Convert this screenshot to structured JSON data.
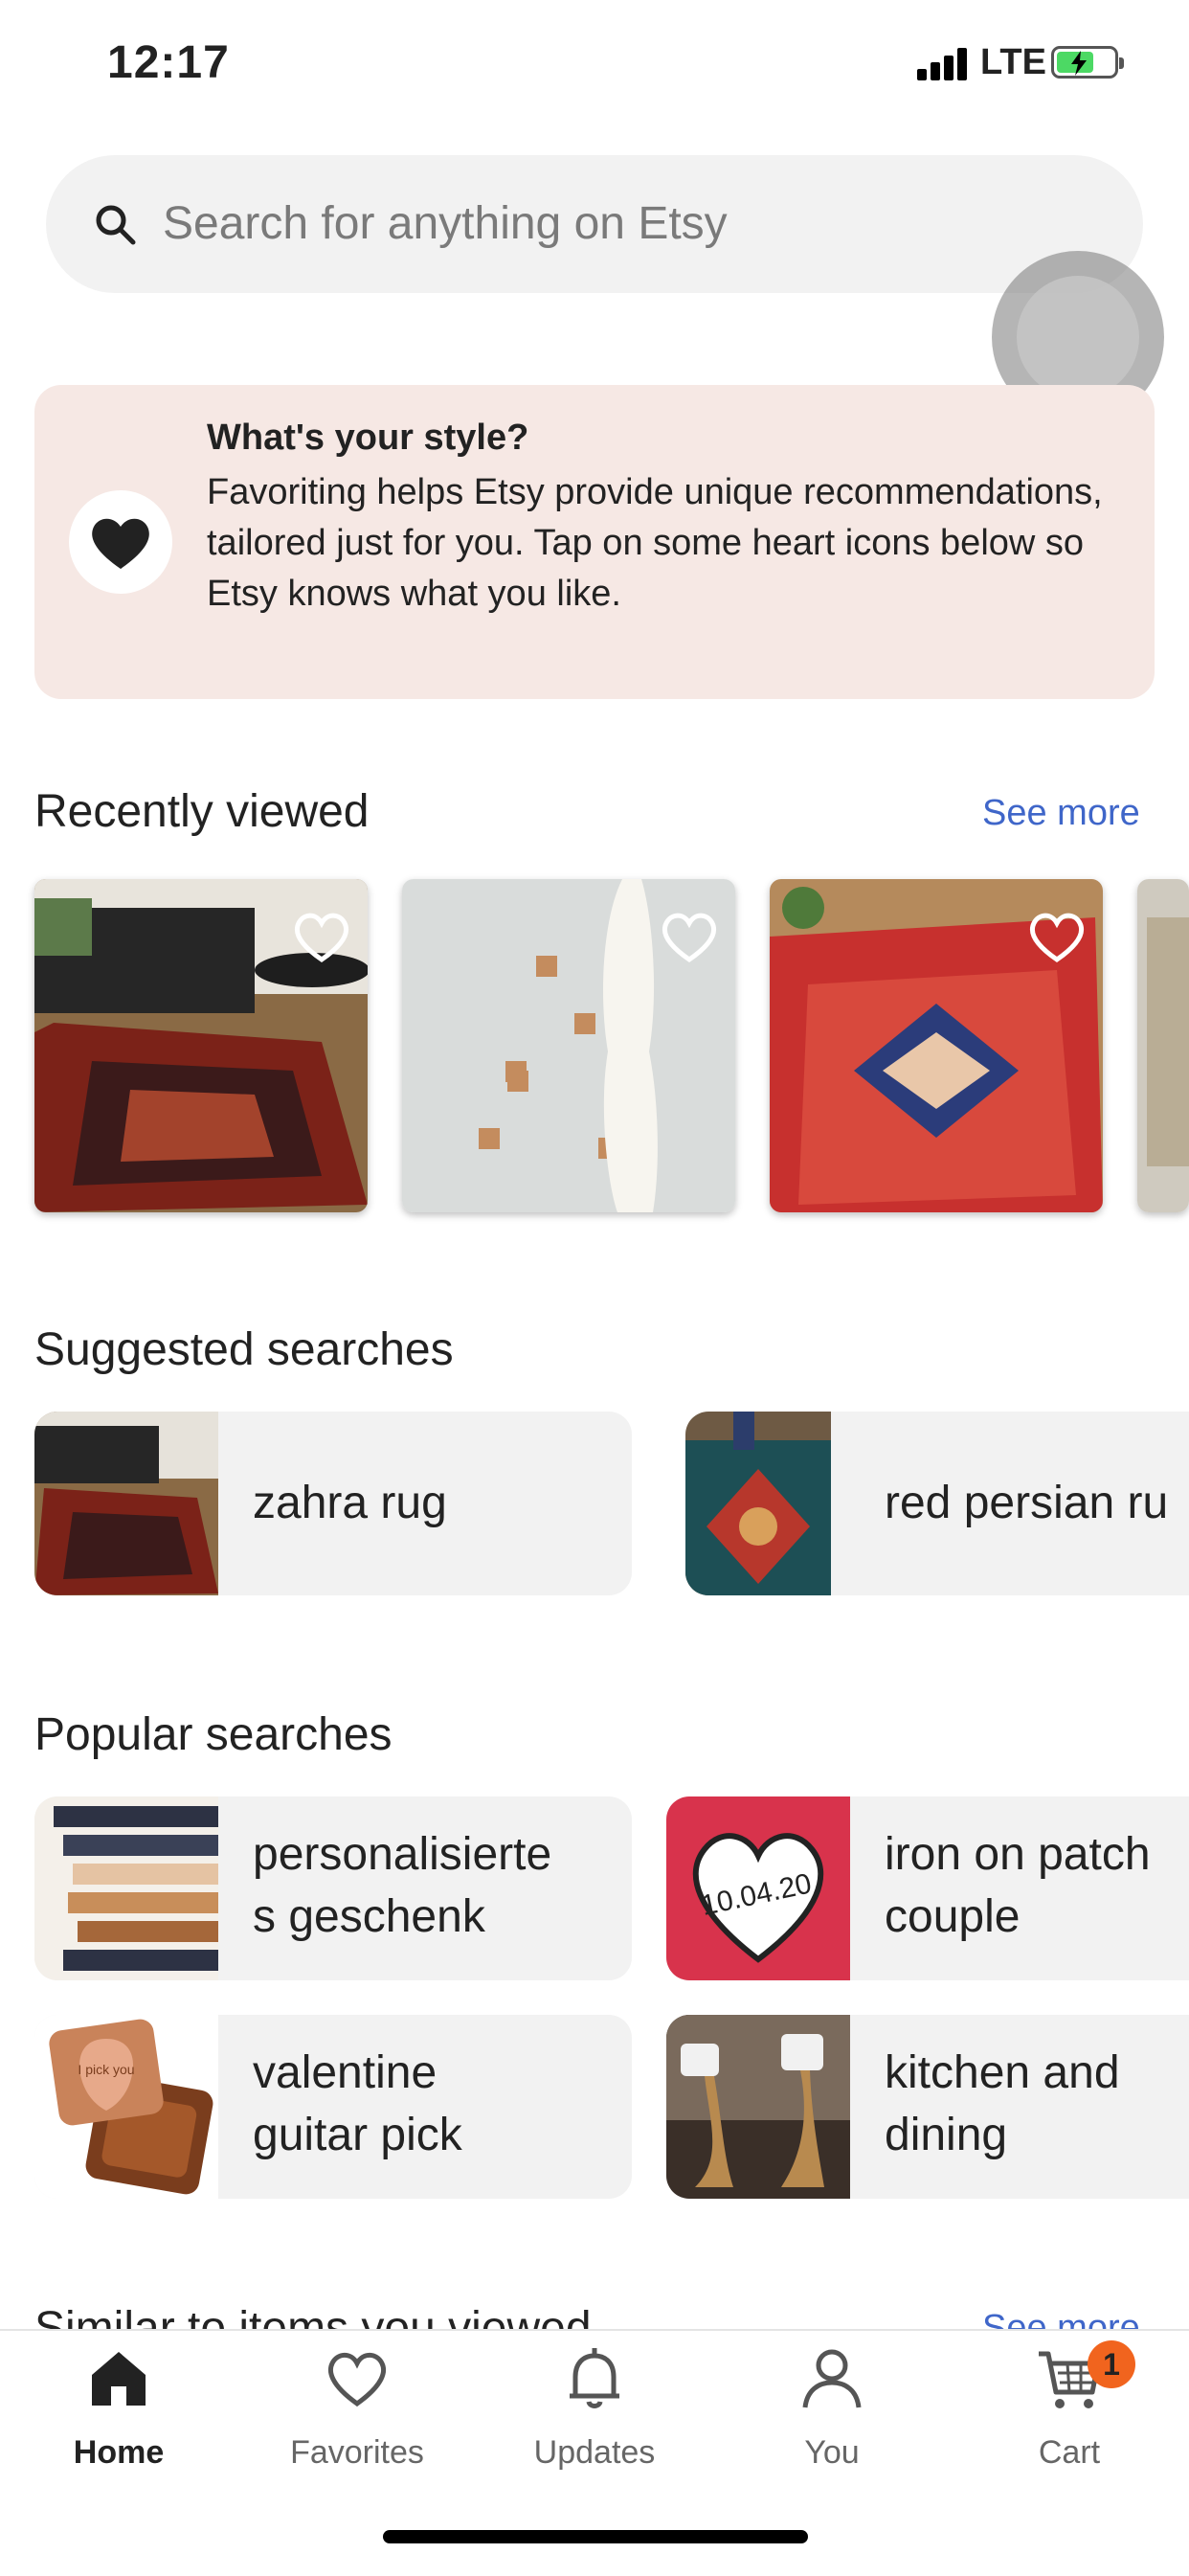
{
  "status_bar": {
    "time": "12:17",
    "network": "LTE"
  },
  "search": {
    "placeholder": "Search for anything on Etsy"
  },
  "style_card": {
    "title": "What's your style?",
    "body": "Favoriting helps Etsy provide unique recommendations, tailored just for you. Tap on some heart icons below so Etsy knows what you like."
  },
  "recently_viewed": {
    "title": "Recently viewed",
    "see_more": "See more",
    "items": [
      {
        "image": "rug-living-room"
      },
      {
        "image": "white-scarf-wall-hooks"
      },
      {
        "image": "red-persian-rug"
      },
      {
        "image": "rug-partial"
      }
    ]
  },
  "suggested_searches": {
    "title": "Suggested searches",
    "items": [
      {
        "label": "zahra rug"
      },
      {
        "label": "red persian ru"
      }
    ]
  },
  "popular_searches": {
    "title": "Popular searches",
    "items": [
      {
        "line1": "personalisierte",
        "line2": "s geschenk"
      },
      {
        "line1": "iron on patch",
        "line2": "couple",
        "image_text": "10.04.20"
      },
      {
        "line1": "valentine",
        "line2": "guitar pick",
        "image_text": "I pick you"
      },
      {
        "line1": "kitchen and",
        "line2": "dining"
      }
    ]
  },
  "similar": {
    "title": "Similar to items you viewed",
    "see_more": "See more"
  },
  "tabbar": {
    "home": "Home",
    "favorites": "Favorites",
    "updates": "Updates",
    "you": "You",
    "cart": "Cart",
    "cart_count": "1"
  },
  "colors": {
    "accent": "#3f66c9",
    "badge": "#f1641e",
    "card_bg": "#f6e8e4"
  }
}
